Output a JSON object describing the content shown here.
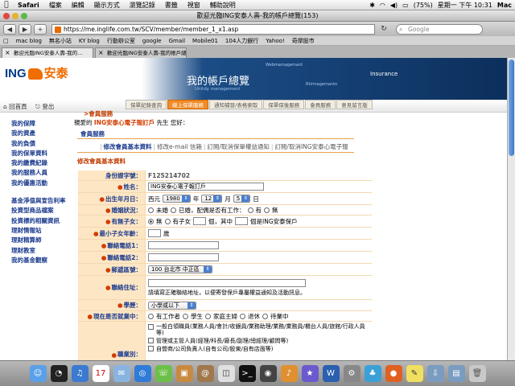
{
  "menubar": {
    "apple": "",
    "app": "Safari",
    "items": [
      "檔案",
      "編輯",
      "顯示方式",
      "瀏覽記錄",
      "書籤",
      "視窗",
      "輔助說明"
    ],
    "battery": "(75%)",
    "clock": "星期一 下午 10:31",
    "user": "Mac"
  },
  "window": {
    "title": "歡迎光臨ING安泰人壽-我的帳戶總覽(153)"
  },
  "toolbar": {
    "back": "◀",
    "forward": "▶",
    "add": "+",
    "url": "https://me.inglife.com.tw/SCV/member/member_1_x1.asp",
    "reload": "↻",
    "search_placeholder": "Google"
  },
  "bookmarks": [
    "□",
    "mac blog",
    "無名小站",
    "KY blog",
    "行動辦公室",
    "google",
    "Gmail",
    "Mobile01",
    "104人力銀行",
    "Yahoo!",
    "奇摩股市"
  ],
  "tabs": [
    {
      "label": "歡迎光臨ING安泰人壽-我的..."
    },
    {
      "label": "歡迎光臨ING安泰人壽-我的帳戶總覽"
    }
  ],
  "banner": {
    "logo_ing": "ING",
    "logo_cn": "安泰",
    "title": "我的帳戶總覽",
    "sub": "Unitdy management",
    "node1": "Webmamagemant",
    "node2": "Insurance",
    "node3": "Rtirmagemanto"
  },
  "nav": {
    "home": "回首頁",
    "logout": "登出"
  },
  "subtabs": [
    "保單紀錄查詢",
    "線上保單服務",
    "通知補發/表格索取",
    "保單保後服務",
    "會員服務",
    "意見留言版"
  ],
  "sidebar": {
    "group1": [
      "我的保障",
      "我的資產",
      "我的負債",
      "我的保單資料",
      "我的繳費紀錄",
      "我的服務人員",
      "我的優惠活動"
    ],
    "group2": [
      "基金淨值與宣告利率",
      "投資型商品檔案",
      "投資標的相關資訊",
      "理財情報站",
      "理財精算師",
      "理財教室",
      "我的基金觀察"
    ]
  },
  "crumb": "會員服務",
  "greeting": {
    "prefix": "親愛的",
    "name": "ING安泰心電子報訂戶",
    "suffix": "先生 您好："
  },
  "service_title": "會員服務",
  "links": [
    "修改會員基本資料",
    "修改e-mail 信箱",
    "訂閱/取消保單權益通知",
    "訂閱/取消ING安泰心電子報"
  ],
  "section": "修改會員基本資料",
  "form": {
    "id_label": "身份證字號：",
    "id_value": "F125214702",
    "name_label": "姓名：",
    "name_value": "ING安泰心電子報訂戶",
    "birth_label": "出生年月日：",
    "birth_prefix": "西元",
    "year": "1980",
    "year_unit": "年",
    "month": "12",
    "month_unit": "月",
    "day": "5",
    "day_unit": "日",
    "marital_label": "婚姻狀況：",
    "marital_opts": [
      "未婚",
      "已婚，配偶是否有工作：",
      "有",
      "無"
    ],
    "kids_label": "有無子女：",
    "kids_opts": [
      "無",
      "有子女",
      "個，其中",
      "個是ING安泰保戶"
    ],
    "youngest_label": "最小子女年齡：",
    "youngest_unit": "歲",
    "phone1_label": "聯絡電話1：",
    "phone2_label": "聯絡電話2：",
    "zip_label": "郵遞區號：",
    "zip_value": "100 台北市 中正區",
    "addr_label": "聯絡住址：",
    "addr_note": "請填寫正確聯絡地址，以便寄發保戶專屬權益通知及活動訊息。",
    "edu_label": "學歷：",
    "edu_value": "小學或以下",
    "job_label": "現在是否就業中：",
    "job_opts": [
      "有工作者",
      "學生",
      "家庭主婦",
      "退休",
      "待業中"
    ],
    "occ_label": "職業別：",
    "occ_opts": [
      "一般白領職員(業務人員/會計/收銀員/業務助理/業務/業務員/櫃台人員/旅館/行政人員等)",
      "管理或主管人員(經理/科長/廠長/副理/總經理/顧問等)",
      "自營商/公司負責人(自有公司/股東/自有店面等)"
    ]
  },
  "dock_icons": [
    "finder-icon",
    "dashboard-icon",
    "itunes-icon",
    "ical-icon",
    "mail-icon",
    "safari-icon",
    "ichat-icon",
    "photos-icon",
    "addressbook-icon",
    "preview-icon",
    "terminal-icon",
    "dvd-icon",
    "garageband-icon",
    "imovie-icon",
    "word-icon",
    "system-prefs-icon",
    "msn-icon",
    "firefox-icon",
    "stickies-icon",
    "downloads-icon",
    "documents-icon",
    "trash-icon"
  ],
  "colors": {
    "accent": "#f08c2a",
    "brand_blue": "#003a8c",
    "label_bg": "#fde6c4",
    "link_blue": "#1a3a8c",
    "required_red": "#d23c00"
  }
}
